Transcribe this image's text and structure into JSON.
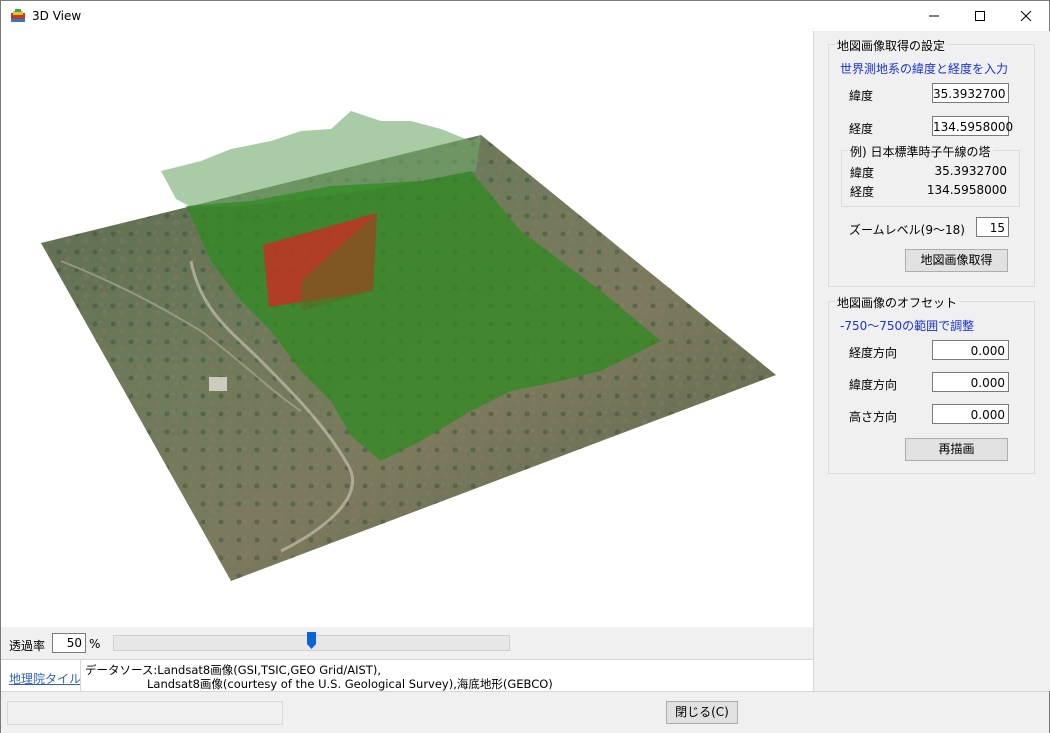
{
  "window": {
    "title": "3D View",
    "controls": [
      "minimize",
      "maximize",
      "close"
    ]
  },
  "map_settings": {
    "group_title": "地図画像取得の設定",
    "instruction": "世界測地系の緯度と経度を入力",
    "latitude_label": "緯度",
    "latitude_value": "35.3932700",
    "longitude_label": "経度",
    "longitude_value": "134.5958000",
    "example_title": "例) 日本標準時子午線の塔",
    "example_latitude_label": "緯度",
    "example_latitude_value": "35.3932700",
    "example_longitude_label": "経度",
    "example_longitude_value": "134.5958000",
    "zoom_label": "ズームレベル(9〜18)",
    "zoom_value": "15",
    "fetch_button": "地図画像取得"
  },
  "offset": {
    "group_title": "地図画像のオフセット",
    "instruction": "-750〜750の範囲で調整",
    "lon_label": "経度方向",
    "lon_value": "0.000",
    "lat_label": "緯度方向",
    "lat_value": "0.000",
    "height_label": "高さ方向",
    "height_value": "0.000",
    "redraw_button": "再描画"
  },
  "transparency": {
    "label": "透過率",
    "value": "50",
    "unit": "%",
    "slider_percent": 50
  },
  "source": {
    "link": "地理院タイル",
    "line1": "データソース:Landsat8画像(GSI,TSIC,GEO Grid/AIST),",
    "line2": "Landsat8画像(courtesy of the U.S. Geological Survey),海底地形(GEBCO)"
  },
  "close_button": "閉じる(C)",
  "colors": {
    "overlay_green": "#2d8a1e",
    "marker_red": "#e02020",
    "accent_blue": "#1a34d6",
    "link_blue": "#2d62c4",
    "slider_thumb": "#0a64d8"
  }
}
